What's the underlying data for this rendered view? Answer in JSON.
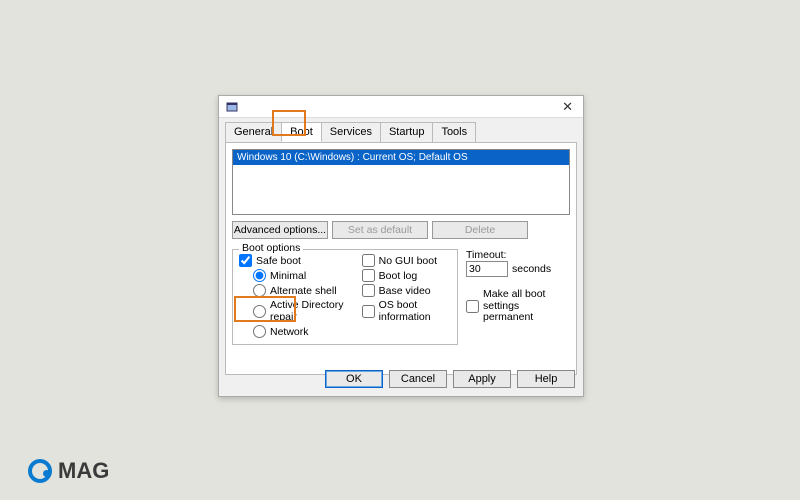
{
  "dialog": {
    "close_glyph": "✕"
  },
  "tabs": [
    "General",
    "Boot",
    "Services",
    "Startup",
    "Tools"
  ],
  "active_tab": 1,
  "os_list": {
    "items": [
      "Windows 10 (C:\\Windows) : Current OS; Default OS"
    ],
    "selected": 0
  },
  "buttons": {
    "advanced": "Advanced options...",
    "set_default": "Set as default",
    "delete": "Delete"
  },
  "boot_options": {
    "legend": "Boot options",
    "safe_boot": {
      "label": "Safe boot",
      "checked": true
    },
    "safe_modes": {
      "minimal": "Minimal",
      "alt_shell": "Alternate shell",
      "ad_repair": "Active Directory repair",
      "network": "Network",
      "selected": "minimal"
    },
    "flags": {
      "no_gui": {
        "label": "No GUI boot",
        "checked": false
      },
      "boot_log": {
        "label": "Boot log",
        "checked": false
      },
      "base_video": {
        "label": "Base video",
        "checked": false
      },
      "os_boot_info": {
        "label": "OS boot information",
        "checked": false
      }
    }
  },
  "timeout": {
    "label": "Timeout:",
    "value": "30",
    "unit": "seconds"
  },
  "permanent": {
    "label": "Make all boot settings permanent",
    "checked": false
  },
  "dialog_buttons": {
    "ok": "OK",
    "cancel": "Cancel",
    "apply": "Apply",
    "help": "Help"
  },
  "watermark": "MAG"
}
